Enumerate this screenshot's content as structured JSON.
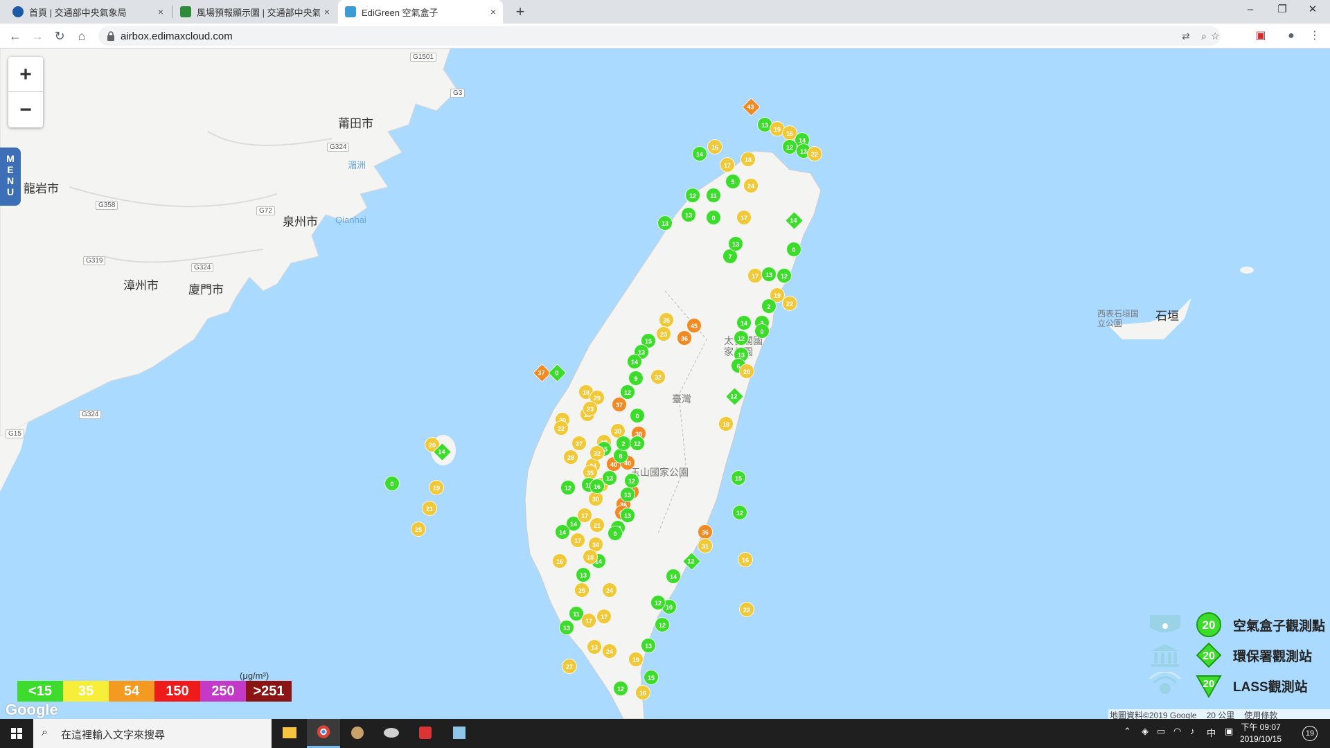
{
  "browser": {
    "tabs": [
      {
        "title": "首頁 | 交通部中央氣象局",
        "favicon_color": "#1b5aa6"
      },
      {
        "title": "風場預報顯示圖 | 交通部中央氣象局",
        "favicon_color": "#2e8b3a"
      },
      {
        "title": "EdiGreen 空氣盒子",
        "favicon_color": "#3a9bd5"
      }
    ],
    "close_glyph": "×",
    "newtab_glyph": "+",
    "url": "airbox.edimaxcloud.com",
    "window_controls": [
      "–",
      "❐",
      "✕"
    ]
  },
  "map": {
    "zoom_in": "+",
    "zoom_out": "−",
    "menu_label": "MENU",
    "place_labels": [
      "莆田市",
      "龍岩市",
      "泉州市",
      "漳州市",
      "廈門市",
      "石垣",
      "西表石垣国立公園",
      "太魯閣國家公園",
      "玉山國家公園",
      "臺灣"
    ],
    "water_labels": [
      "湄洲",
      "Qianhai"
    ],
    "road_shields": [
      "G1501",
      "G3",
      "G324",
      "G358",
      "G72",
      "G319",
      "G324",
      "G324",
      "G15"
    ],
    "colors": {
      "sea": "#aadaff",
      "land": "#f4f4f2",
      "green": "#3ddc2c",
      "yellow": "#f0c93a",
      "orange": "#ef8a25"
    }
  },
  "markers": [
    {
      "v": "43",
      "c": "orange",
      "s": "d"
    },
    {
      "v": "13",
      "c": "green"
    },
    {
      "v": "19",
      "c": "yellow"
    },
    {
      "v": "16",
      "c": "yellow"
    },
    {
      "v": "14",
      "c": "green"
    },
    {
      "v": "13",
      "c": "green"
    },
    {
      "v": "12",
      "c": "green"
    },
    {
      "v": "22",
      "c": "yellow"
    },
    {
      "v": "14",
      "c": "green"
    },
    {
      "v": "16",
      "c": "yellow"
    },
    {
      "v": "17",
      "c": "yellow"
    },
    {
      "v": "18",
      "c": "yellow"
    },
    {
      "v": "5",
      "c": "green"
    },
    {
      "v": "24",
      "c": "yellow"
    },
    {
      "v": "12",
      "c": "green"
    },
    {
      "v": "11",
      "c": "green"
    },
    {
      "v": "13",
      "c": "green"
    },
    {
      "v": "0",
      "c": "green"
    },
    {
      "v": "13",
      "c": "green"
    },
    {
      "v": "17",
      "c": "yellow"
    },
    {
      "v": "14",
      "c": "green",
      "s": "d"
    },
    {
      "v": "0",
      "c": "green"
    },
    {
      "v": "7",
      "c": "green"
    },
    {
      "v": "13",
      "c": "green"
    },
    {
      "v": "17",
      "c": "yellow"
    },
    {
      "v": "12",
      "c": "green"
    },
    {
      "v": "13",
      "c": "green"
    },
    {
      "v": "19",
      "c": "yellow"
    },
    {
      "v": "22",
      "c": "yellow"
    },
    {
      "v": "2",
      "c": "green"
    },
    {
      "v": "3",
      "c": "green"
    },
    {
      "v": "0",
      "c": "green"
    },
    {
      "v": "14",
      "c": "green"
    },
    {
      "v": "12",
      "c": "green"
    },
    {
      "v": "13",
      "c": "green"
    },
    {
      "v": "6",
      "c": "green"
    },
    {
      "v": "20",
      "c": "yellow"
    },
    {
      "v": "12",
      "c": "green",
      "s": "d"
    },
    {
      "v": "18",
      "c": "yellow"
    },
    {
      "v": "45",
      "c": "orange"
    },
    {
      "v": "35",
      "c": "yellow"
    },
    {
      "v": "36",
      "c": "orange"
    },
    {
      "v": "23",
      "c": "yellow"
    },
    {
      "v": "15",
      "c": "green"
    },
    {
      "v": "13",
      "c": "green"
    },
    {
      "v": "14",
      "c": "green"
    },
    {
      "v": "9",
      "c": "green"
    },
    {
      "v": "32",
      "c": "yellow"
    },
    {
      "v": "12",
      "c": "green"
    },
    {
      "v": "37",
      "c": "orange",
      "s": "d"
    },
    {
      "v": "0",
      "c": "green",
      "s": "d"
    },
    {
      "v": "18",
      "c": "yellow"
    },
    {
      "v": "29",
      "c": "yellow"
    },
    {
      "v": "37",
      "c": "orange"
    },
    {
      "v": "16",
      "c": "yellow"
    },
    {
      "v": "0",
      "c": "green"
    },
    {
      "v": "38",
      "c": "orange"
    },
    {
      "v": "30",
      "c": "yellow"
    },
    {
      "v": "18",
      "c": "yellow"
    },
    {
      "v": "15",
      "c": "green"
    },
    {
      "v": "40",
      "c": "orange"
    },
    {
      "v": "24",
      "c": "yellow"
    },
    {
      "v": "16",
      "c": "yellow"
    },
    {
      "v": "40",
      "c": "orange"
    },
    {
      "v": "36",
      "c": "orange"
    },
    {
      "v": "44",
      "c": "orange"
    },
    {
      "v": "40",
      "c": "orange"
    },
    {
      "v": "13",
      "c": "green"
    },
    {
      "v": "14",
      "c": "green"
    },
    {
      "v": "15",
      "c": "green"
    },
    {
      "v": "12",
      "c": "green"
    },
    {
      "v": "36",
      "c": "orange"
    },
    {
      "v": "31",
      "c": "yellow"
    },
    {
      "v": "0",
      "c": "green"
    },
    {
      "v": "14",
      "c": "green"
    },
    {
      "v": "12",
      "c": "green",
      "s": "d"
    },
    {
      "v": "14",
      "c": "green"
    },
    {
      "v": "10",
      "c": "green"
    },
    {
      "v": "12",
      "c": "green"
    },
    {
      "v": "13",
      "c": "green"
    },
    {
      "v": "12",
      "c": "green"
    },
    {
      "v": "16",
      "c": "yellow"
    },
    {
      "v": "22",
      "c": "yellow"
    },
    {
      "v": "25",
      "c": "yellow"
    },
    {
      "v": "24",
      "c": "yellow"
    },
    {
      "v": "17",
      "c": "yellow"
    },
    {
      "v": "11",
      "c": "green"
    },
    {
      "v": "13",
      "c": "green"
    },
    {
      "v": "27",
      "c": "yellow"
    },
    {
      "v": "12",
      "c": "green"
    },
    {
      "v": "16",
      "c": "yellow"
    },
    {
      "v": "15",
      "c": "green"
    },
    {
      "v": "19",
      "c": "yellow"
    },
    {
      "v": "24",
      "c": "yellow"
    },
    {
      "v": "13",
      "c": "yellow"
    },
    {
      "v": "17",
      "c": "yellow"
    },
    {
      "v": "20",
      "c": "yellow"
    },
    {
      "v": "14",
      "c": "green",
      "s": "d"
    },
    {
      "v": "0",
      "c": "green"
    },
    {
      "v": "19",
      "c": "yellow"
    },
    {
      "v": "21",
      "c": "yellow"
    },
    {
      "v": "25",
      "c": "yellow"
    },
    {
      "v": "20",
      "c": "yellow"
    },
    {
      "v": "23",
      "c": "yellow"
    },
    {
      "v": "22",
      "c": "yellow"
    },
    {
      "v": "27",
      "c": "yellow"
    },
    {
      "v": "32",
      "c": "yellow"
    },
    {
      "v": "35",
      "c": "yellow"
    },
    {
      "v": "28",
      "c": "yellow"
    },
    {
      "v": "30",
      "c": "yellow"
    },
    {
      "v": "21",
      "c": "yellow"
    },
    {
      "v": "34",
      "c": "yellow"
    },
    {
      "v": "12",
      "c": "green"
    },
    {
      "v": "14",
      "c": "green"
    },
    {
      "v": "17",
      "c": "yellow"
    },
    {
      "v": "18",
      "c": "yellow"
    },
    {
      "v": "13",
      "c": "green"
    },
    {
      "v": "16",
      "c": "yellow"
    },
    {
      "v": "14",
      "c": "green"
    },
    {
      "v": "17",
      "c": "yellow"
    },
    {
      "v": "12",
      "c": "green"
    },
    {
      "v": "13",
      "c": "green"
    },
    {
      "v": "8",
      "c": "green"
    },
    {
      "v": "2",
      "c": "green"
    },
    {
      "v": "12",
      "c": "green"
    },
    {
      "v": "12",
      "c": "green"
    },
    {
      "v": "13",
      "c": "green"
    },
    {
      "v": "16",
      "c": "green"
    }
  ],
  "legend": {
    "scale": [
      {
        "label": "<15",
        "color": "#3ddc2c"
      },
      {
        "label": "35",
        "color": "#f6ee39"
      },
      {
        "label": "54",
        "color": "#f59a20"
      },
      {
        "label": "150",
        "color": "#ef1a1a"
      },
      {
        "label": "250",
        "color": "#c33ac8"
      },
      {
        "label": ">251",
        "color": "#8b1414"
      }
    ],
    "unit": "(μg/m³)",
    "types": [
      {
        "label": "空氣盒子觀測點",
        "value": "20",
        "icon": "airbox-device-icon"
      },
      {
        "label": "環保署觀測站",
        "value": "20",
        "icon": "government-building-icon"
      },
      {
        "label": "LASS觀測站",
        "value": "20",
        "icon": "lass-sensor-icon"
      }
    ]
  },
  "google_logo": "Google",
  "attribution": {
    "data": "地圖資料©2019 Google",
    "scale": "20 公里",
    "terms": "使用條款"
  },
  "taskbar": {
    "search_placeholder": "在這裡輸入文字來搜尋",
    "time": "下午 09:07",
    "date": "2019/10/15",
    "ime": "中",
    "notifications": "19"
  }
}
